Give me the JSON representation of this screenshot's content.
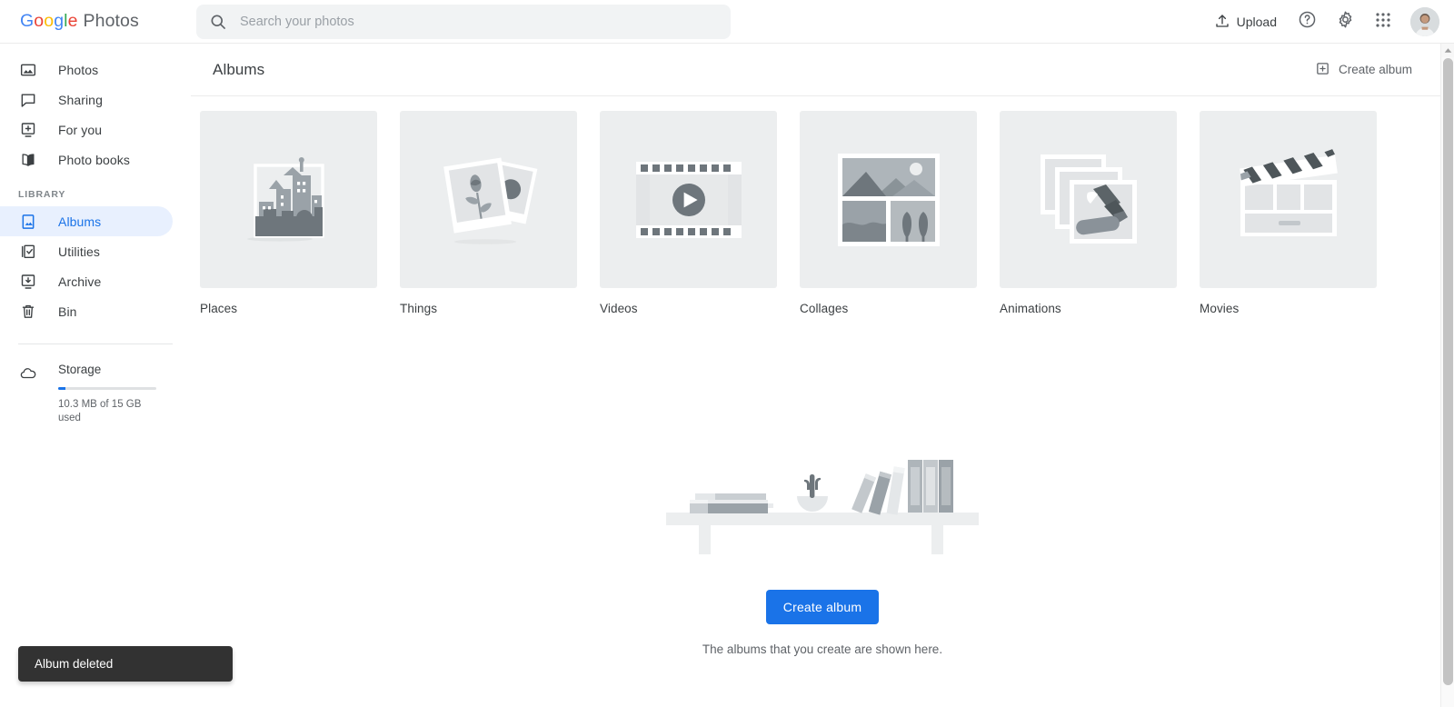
{
  "app": {
    "brand_google": "Google",
    "brand_product": "Photos"
  },
  "search": {
    "placeholder": "Search your photos",
    "value": "",
    "icon": "search-icon"
  },
  "toolbar": {
    "upload_label": "Upload",
    "upload_icon": "upload-icon",
    "help_icon": "help-circle-icon",
    "settings_icon": "gear-icon",
    "apps_icon": "apps-grid-icon",
    "avatar_icon": "user-avatar"
  },
  "sidebar": {
    "items": [
      {
        "label": "Photos",
        "icon": "photo-icon",
        "active": false
      },
      {
        "label": "Sharing",
        "icon": "chat-bubble-icon",
        "active": false
      },
      {
        "label": "For you",
        "icon": "for-you-icon",
        "active": false
      },
      {
        "label": "Photo books",
        "icon": "open-book-icon",
        "active": false
      }
    ],
    "section_label": "LIBRARY",
    "library_items": [
      {
        "label": "Albums",
        "icon": "album-icon",
        "active": true
      },
      {
        "label": "Utilities",
        "icon": "utilities-check-icon",
        "active": false
      },
      {
        "label": "Archive",
        "icon": "archive-icon",
        "active": false
      },
      {
        "label": "Bin",
        "icon": "trash-icon",
        "active": false
      }
    ],
    "storage": {
      "title": "Storage",
      "icon": "cloud-icon",
      "usage_text": "10.3 MB of 15 GB used",
      "percent": 0.07
    }
  },
  "header": {
    "title": "Albums",
    "create_album_label": "Create album",
    "create_album_icon": "add-box-icon"
  },
  "tiles": [
    {
      "label": "Places",
      "art": "cityscape-art"
    },
    {
      "label": "Things",
      "art": "tulip-photos-art"
    },
    {
      "label": "Videos",
      "art": "filmstrip-play-art"
    },
    {
      "label": "Collages",
      "art": "collage-grid-art"
    },
    {
      "label": "Animations",
      "art": "photo-stack-art"
    },
    {
      "label": "Movies",
      "art": "clapperboard-art"
    }
  ],
  "empty_state": {
    "art": "bookshelf-art",
    "cta_label": "Create album",
    "subtitle": "The albums that you create are shown here."
  },
  "toast": {
    "message": "Album deleted"
  },
  "colors": {
    "accent": "#1a73e8",
    "active_pill": "#e8f0fe",
    "tile_bg": "#eceeef",
    "toast_bg": "#323232",
    "text_primary": "#3c4043",
    "text_secondary": "#5f6368"
  }
}
